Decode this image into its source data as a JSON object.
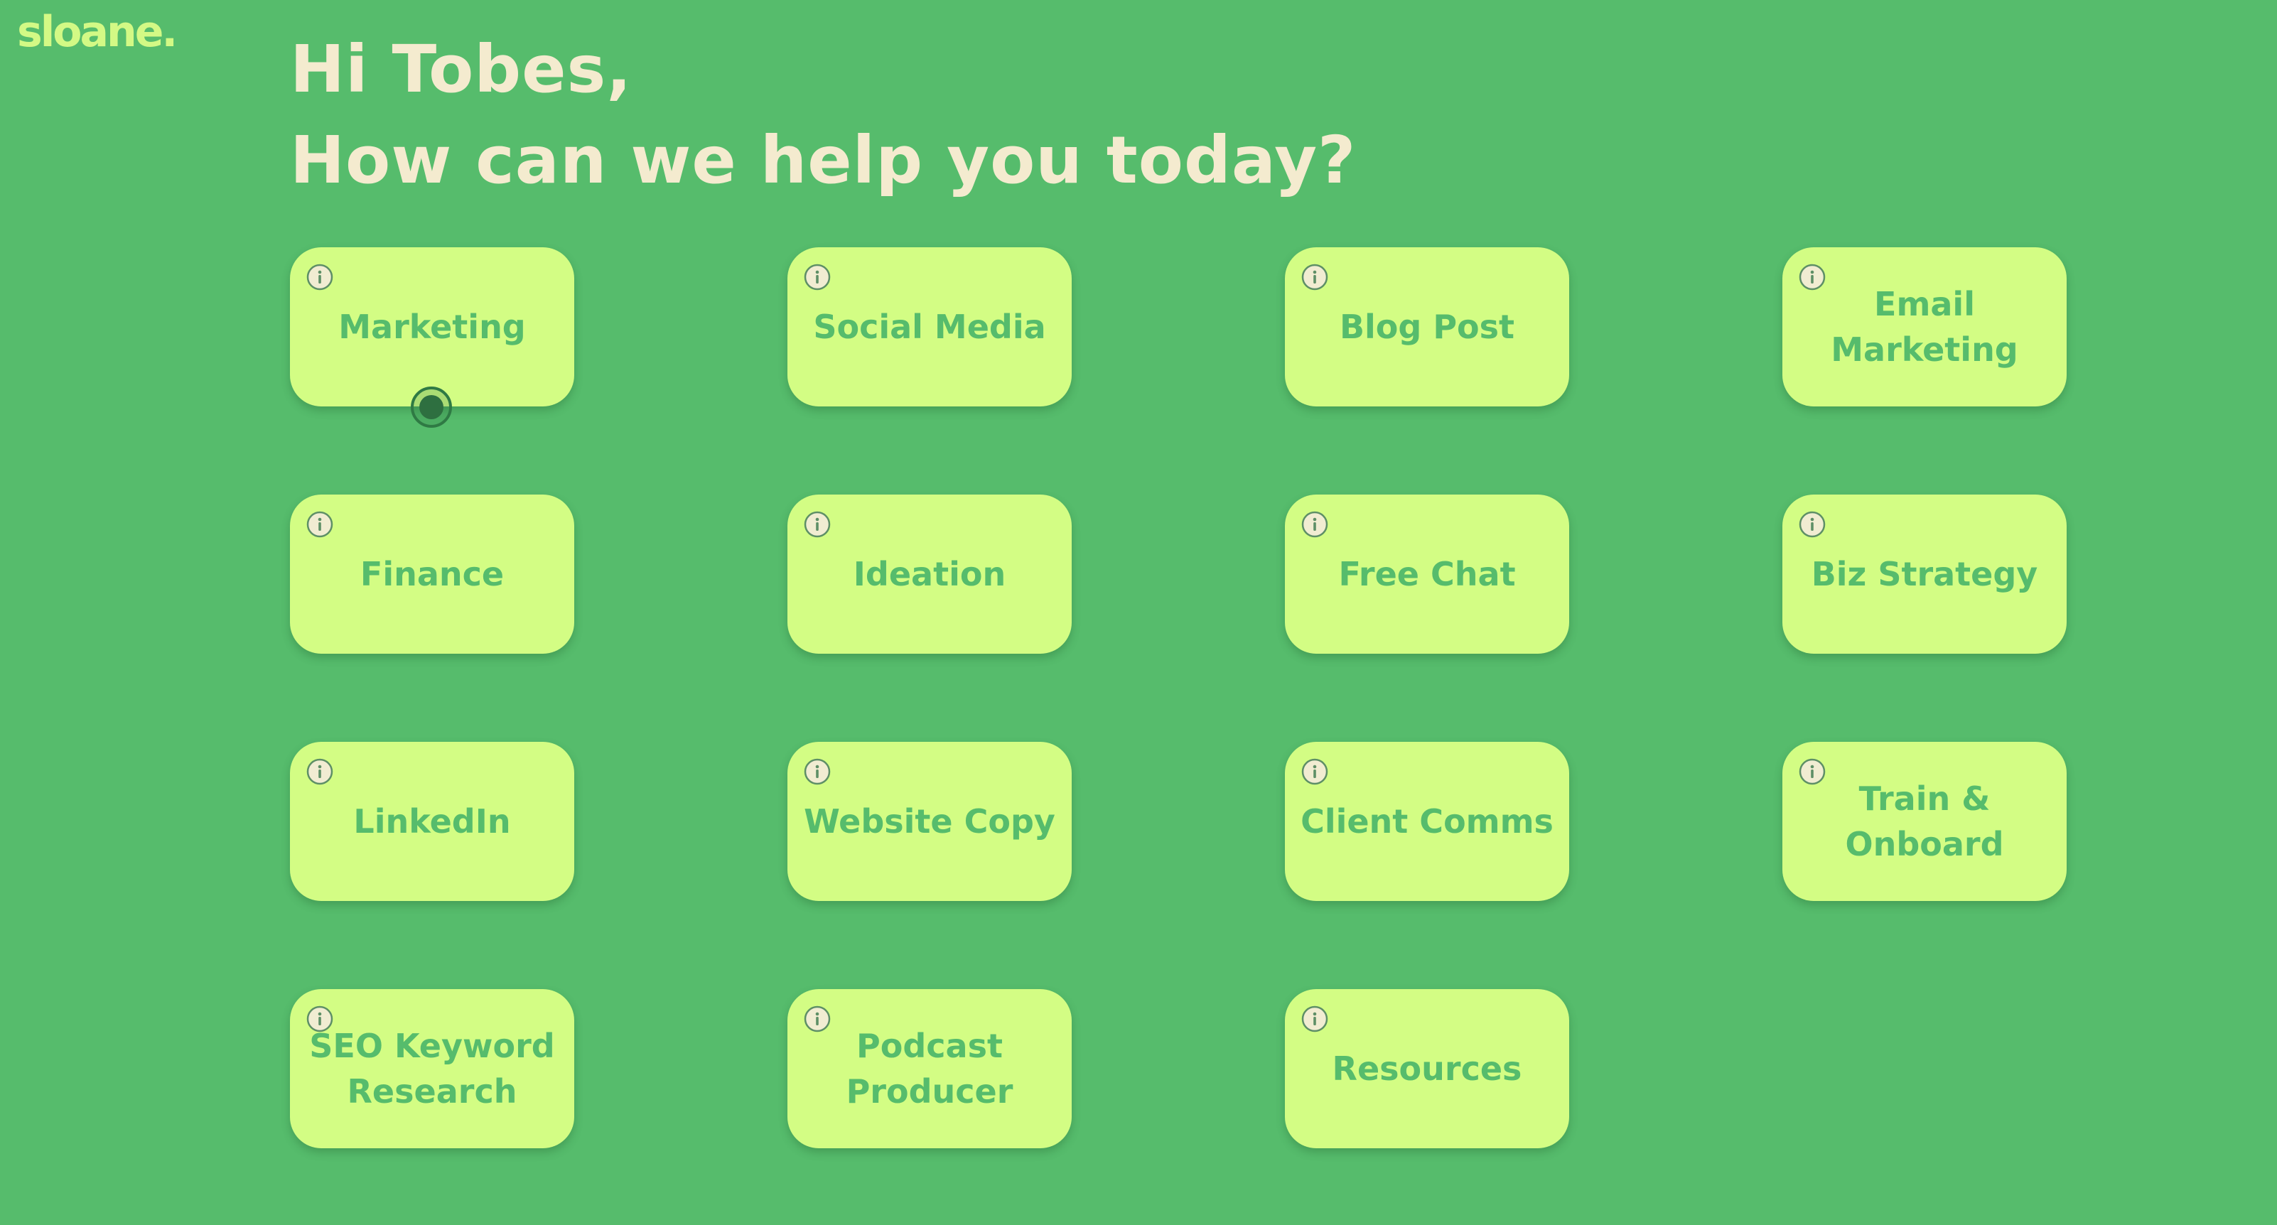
{
  "app": {
    "logo": "sloane."
  },
  "header": {
    "greeting_line1": "Hi Tobes,",
    "greeting_line2": "How can we help you today?"
  },
  "colors": {
    "background": "#56bc6c",
    "card": "#d3fd84",
    "card_text": "#56bc6c",
    "heading": "#f4ebcf",
    "logo": "#d3f985"
  },
  "cards": [
    {
      "label": "Marketing",
      "icon": "info-icon"
    },
    {
      "label": "Social Media",
      "icon": "info-icon"
    },
    {
      "label": "Blog Post",
      "icon": "info-icon"
    },
    {
      "label": "Email Marketing",
      "icon": "info-icon"
    },
    {
      "label": "Finance",
      "icon": "info-icon"
    },
    {
      "label": "Ideation",
      "icon": "info-icon"
    },
    {
      "label": "Free Chat",
      "icon": "info-icon"
    },
    {
      "label": "Biz Strategy",
      "icon": "info-icon"
    },
    {
      "label": "LinkedIn",
      "icon": "info-icon"
    },
    {
      "label": "Website Copy",
      "icon": "info-icon"
    },
    {
      "label": "Client Comms",
      "icon": "info-icon"
    },
    {
      "label": "Train & Onboard",
      "icon": "info-icon"
    },
    {
      "label": "SEO Keyword Research",
      "icon": "info-icon"
    },
    {
      "label": "Podcast Producer",
      "icon": "info-icon"
    },
    {
      "label": "Resources",
      "icon": "info-icon"
    }
  ]
}
